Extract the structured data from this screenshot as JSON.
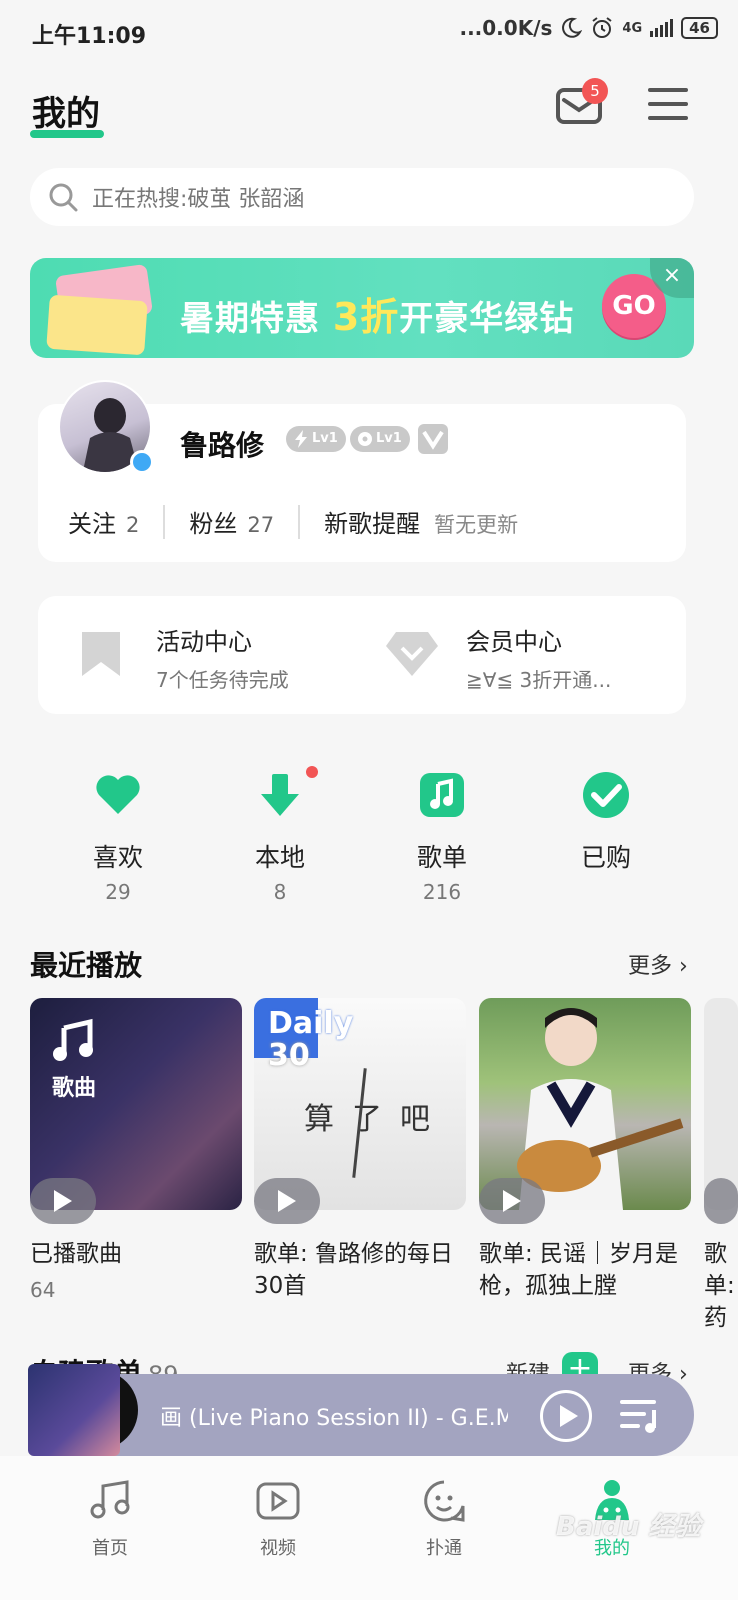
{
  "status_bar": {
    "time": "上午11:09",
    "net_speed": "...0.0K/s",
    "network": "4G",
    "battery": "46"
  },
  "header": {
    "title": "我的",
    "mail_badge_count": "5"
  },
  "search": {
    "placeholder": "正在热搜:破茧 张韶涵"
  },
  "banner": {
    "text_before": "暑期特惠 ",
    "highlight": "3折",
    "text_after": "开豪华绿钻",
    "go_label": "GO",
    "close": "×"
  },
  "profile": {
    "username": "鲁路修",
    "badge1": "Lv1",
    "badge2": "Lv1",
    "follow_label": "关注",
    "follow_count": "2",
    "fans_label": "粉丝",
    "fans_count": "27",
    "new_song_label": "新歌提醒",
    "new_song_status": "暂无更新"
  },
  "centers": {
    "activity": {
      "title": "活动中心",
      "subtitle": "7个任务待完成"
    },
    "vip": {
      "title": "会员中心",
      "subtitle": "≧∀≦ 3折开通..."
    }
  },
  "quick_items": [
    {
      "label": "喜欢",
      "count": "29",
      "icon": "heart-icon"
    },
    {
      "label": "本地",
      "count": "8",
      "icon": "download-icon"
    },
    {
      "label": "歌单",
      "count": "216",
      "icon": "music-note-icon"
    },
    {
      "label": "已购",
      "count": "",
      "icon": "check-icon"
    }
  ],
  "recent": {
    "title": "最近播放",
    "more": "更多",
    "items": [
      {
        "overlay": "歌曲",
        "caption": "已播歌曲",
        "count": "64"
      },
      {
        "overlay_top": "Daily",
        "overlay_num": "30",
        "cover_text": "算了吧",
        "caption": "歌单: 鲁路修的每日30首"
      },
      {
        "caption": "歌单: 民谣｜岁月是枪，孤独上膛"
      },
      {
        "caption": "歌单: 药"
      }
    ]
  },
  "self_built": {
    "title": "自建歌单",
    "count": "89",
    "new_label": "新建",
    "plus": "+",
    "more": "更多"
  },
  "player": {
    "title": "画 (Live Piano Session II) - G.E.M."
  },
  "bottom_nav": [
    {
      "label": "首页",
      "icon": "home-note-icon"
    },
    {
      "label": "视频",
      "icon": "video-icon"
    },
    {
      "label": "扑通",
      "icon": "chat-face-icon"
    },
    {
      "label": "我的",
      "icon": "profile-icon"
    }
  ],
  "watermark": "Baidu 经验",
  "colors": {
    "accent": "#22c78a",
    "badge_red": "#f25555",
    "player_bg": "#a3a4c0"
  }
}
